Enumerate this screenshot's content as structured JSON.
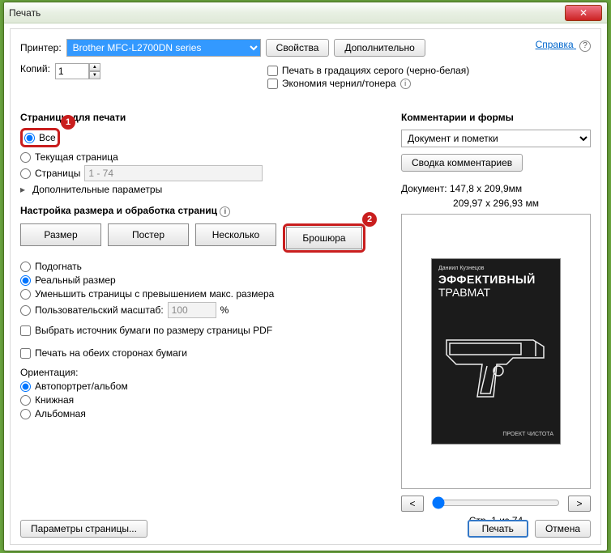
{
  "window": {
    "title": "Печать",
    "close_glyph": "✕"
  },
  "help": {
    "label": "Справка",
    "glyph": "?"
  },
  "printer": {
    "label": "Принтер:",
    "selected": "Brother MFC-L2700DN series",
    "properties_btn": "Свойства",
    "advanced_btn": "Дополнительно"
  },
  "copies": {
    "label": "Копий:",
    "value": "1"
  },
  "right_checks": {
    "grayscale": "Печать в градациях серого (черно-белая)",
    "save_ink": "Экономия чернил/тонера",
    "info": "ⓘ"
  },
  "pages": {
    "heading": "Страницы для печати",
    "all": "Все",
    "current": "Текущая страница",
    "range_label": "Страницы",
    "range_value": "1 - 74",
    "extra": "Дополнительные параметры",
    "tri": "▸"
  },
  "sizing": {
    "heading": "Настройка размера и обработка страниц",
    "info": "ⓘ",
    "tabs": {
      "size": "Размер",
      "poster": "Постер",
      "multiple": "Несколько",
      "booklet": "Брошюра"
    },
    "fit": "Подогнать",
    "actual": "Реальный размер",
    "shrink": "Уменьшить страницы с превышением макс. размера",
    "custom_label": "Пользовательский масштаб:",
    "custom_value": "100",
    "custom_pct": "%",
    "paper_source": "Выбрать источник бумаги по размеру страницы PDF",
    "duplex": "Печать на обеих сторонах бумаги"
  },
  "orientation": {
    "heading": "Ориентация:",
    "auto": "Автопортрет/альбом",
    "portrait": "Книжная",
    "landscape": "Альбомная"
  },
  "comments": {
    "heading": "Комментарии и формы",
    "dropdown": "Документ и пометки",
    "summary_btn": "Сводка комментариев"
  },
  "preview": {
    "doc_size": "Документ: 147,8 x 209,9мм",
    "paper_size": "209,97 x 296,93 мм",
    "author": "Даниил Кузнецов",
    "title1": "ЭФФЕКТИВНЫЙ",
    "title2": "ТРАВМАТ",
    "footer": "ПРОЕКТ ЧИСТОТА",
    "prev": "<",
    "next": ">",
    "page_of": "Стр. 1 из 74"
  },
  "footer": {
    "page_setup": "Параметры страницы...",
    "print": "Печать",
    "cancel": "Отмена"
  },
  "callouts": {
    "one": "1",
    "two": "2"
  }
}
